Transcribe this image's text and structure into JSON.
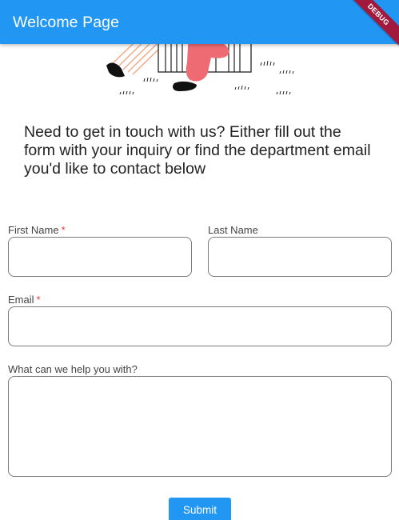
{
  "appbar": {
    "title": "Welcome Page",
    "color": "#2196f3"
  },
  "debug_banner": {
    "label": "DEBUG"
  },
  "intro": {
    "text": "Need to get in touch with us? Either fill out the form with your inquiry or find the department email you'd like to contact below"
  },
  "form": {
    "first_name": {
      "label": "First Name",
      "required_mark": "*",
      "value": ""
    },
    "last_name": {
      "label": "Last Name",
      "value": ""
    },
    "email": {
      "label": "Email",
      "required_mark": "*",
      "value": ""
    },
    "message": {
      "label": "What can we help you with?",
      "value": ""
    },
    "submit_label": "Submit"
  },
  "colors": {
    "accent": "#2196f3",
    "required": "#e53935",
    "illustration_pink": "#ef6b73"
  }
}
